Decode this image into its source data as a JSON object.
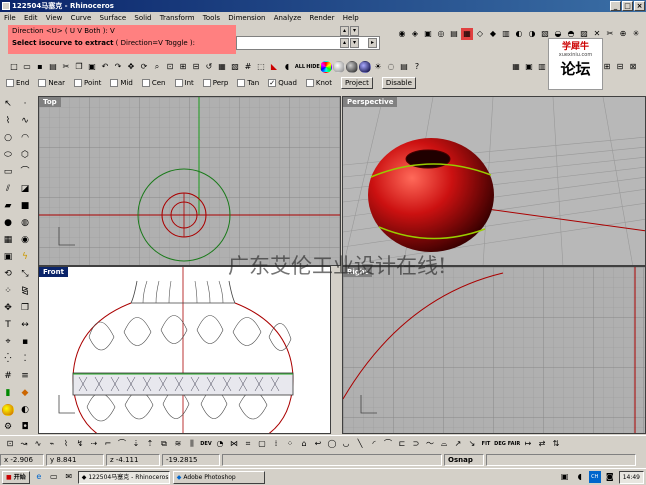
{
  "window": {
    "title": "122504马塞克 - Rhinoceros"
  },
  "menu": [
    "File",
    "Edit",
    "View",
    "Curve",
    "Surface",
    "Solid",
    "Transform",
    "Tools",
    "Dimension",
    "Analyze",
    "Render",
    "Help"
  ],
  "command": {
    "line1": "Direction <U> ( U  V  Both ): V",
    "line2_prompt": "Select isocurve to extract",
    "line2_options": " ( Direction=V  Toggle ): "
  },
  "toolbar2": {
    "all_label": "ALL",
    "hide_label": "HIDE"
  },
  "osnap": {
    "items": [
      {
        "label": "End",
        "checked": false
      },
      {
        "label": "Near",
        "checked": false
      },
      {
        "label": "Point",
        "checked": false
      },
      {
        "label": "Mid",
        "checked": false
      },
      {
        "label": "Cen",
        "checked": false
      },
      {
        "label": "Int",
        "checked": false
      },
      {
        "label": "Perp",
        "checked": false
      },
      {
        "label": "Tan",
        "checked": false
      },
      {
        "label": "Quad",
        "checked": true
      },
      {
        "label": "Knot",
        "checked": false
      }
    ],
    "project_label": "Project",
    "disable_label": "Disable"
  },
  "viewports": {
    "top": {
      "title": "Top"
    },
    "perspective": {
      "title": "Perspective"
    },
    "front": {
      "title": "Front"
    },
    "right": {
      "title": "Right"
    }
  },
  "watermark": "广东艾伦工业设计在线!",
  "logo": {
    "line1": "学犀牛",
    "line2": "xuexiniu.com",
    "line3": "论坛"
  },
  "bottom_toolbar": {
    "fit_label": "FIT",
    "deg_label": "DEG",
    "fair_label": "FAIR"
  },
  "status": {
    "x": "x -2.906",
    "y": "y 8.841",
    "z": "z -4.111",
    "extra": "-19.2815",
    "osnap": "Osnap"
  },
  "taskbar": {
    "start_label": "开始",
    "task1": "122504马塞克 - Rhinoceros",
    "task2": "Adobe Photoshop",
    "ime": "CH",
    "clock": "14:49"
  },
  "colors": {
    "accent": "#0a246a",
    "command_highlight": "#ff8080",
    "viewport_bg": "#b0b0b0",
    "sphere": "#cc1111"
  }
}
